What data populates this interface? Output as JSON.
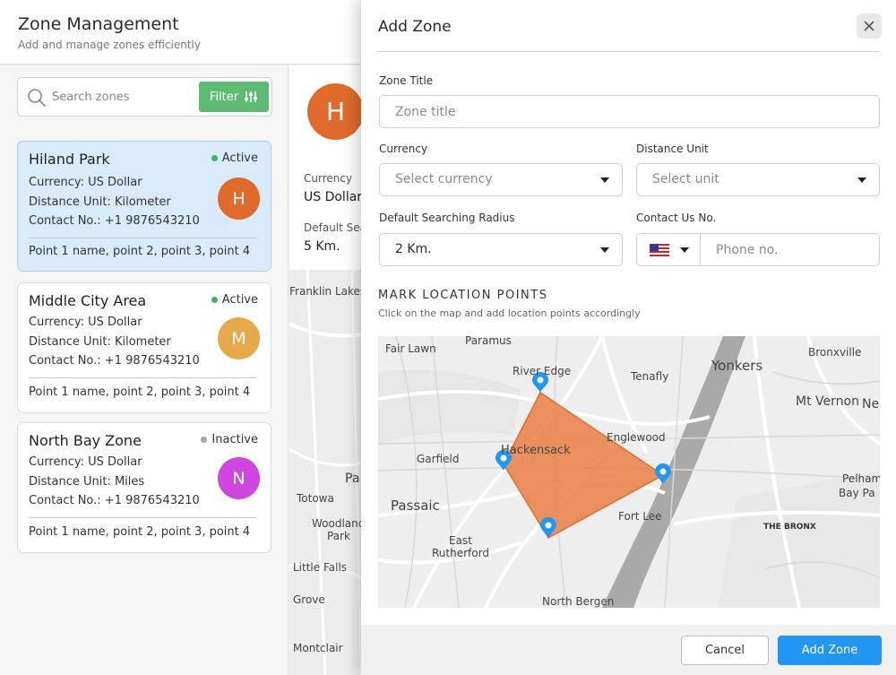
{
  "header": {
    "title": "Zone Management",
    "subtitle": "Add and manage zones efficiently"
  },
  "search": {
    "placeholder": "Search zones",
    "filter_label": "Filter"
  },
  "zones": [
    {
      "name": "Hiland Park",
      "status": "Active",
      "currency": "Currency: US Dollar",
      "distance_unit": "Distance Unit: Kilometer",
      "contact": "Contact No.:  +1 9876543210",
      "initial": "H",
      "points": "Point 1 name, point 2, point 3, point 4"
    },
    {
      "name": "Middle City Area",
      "status": "Active",
      "currency": "Currency: US Dollar",
      "distance_unit": "Distance Unit: Kilometer",
      "contact": "Contact No.:  +1 9876543210",
      "initial": "M",
      "points": "Point 1 name, point 2, point 3, point 4"
    },
    {
      "name": "North Bay Zone",
      "status": "Inactive",
      "currency": "Currency: US Dollar",
      "distance_unit": "Distance Unit: Miles",
      "contact": "Contact No.:  +1 9876543210",
      "initial": "N",
      "points": "Point 1 name, point 2, point 3, point 4"
    }
  ],
  "detail": {
    "initial": "H",
    "currency_label": "Currency",
    "currency_value": "US Dollar",
    "radius_label": "Default Sea",
    "radius_value": "5 Km.",
    "map_labels": [
      "Franklin Lakes",
      "Pa",
      "Totowa",
      "Woodland",
      "Park",
      "Little Falls",
      "Grove",
      "Montclair"
    ]
  },
  "drawer": {
    "title": "Add Zone",
    "zone_title_label": "Zone Title",
    "zone_title_placeholder": "Zone title",
    "currency_label": "Currency",
    "currency_placeholder": "Select currency",
    "distance_unit_label": "Distance Unit",
    "distance_unit_placeholder": "Select unit",
    "radius_label": "Default Searching Radius",
    "radius_value": "2 Km.",
    "contact_label": "Contact Us No.",
    "phone_placeholder": "Phone no.",
    "section_title": "MARK LOCATION POINTS",
    "section_subtitle": "Click on the map and add location points accordingly",
    "cancel_label": "Cancel",
    "submit_label": "Add Zone"
  },
  "map": {
    "labels": {
      "fair_lawn": "Fair Lawn",
      "paramus": "Paramus",
      "river_edge": "River Edge",
      "yonkers": "Yonkers",
      "bronxville": "Bronxville",
      "tenafly": "Tenafly",
      "mt_vernon": "Mt Vernon",
      "ne": "Ne",
      "hackensack": "Hackensack",
      "englewood": "Englewood",
      "garfield": "Garfield",
      "passaic": "Passaic",
      "fort_lee": "Fort Lee",
      "pelham": "Pelham",
      "bay_pa": "Bay Pa",
      "the_bronx": "THE BRONX",
      "east": "East",
      "rutherford": "Rutherford",
      "north_bergen": "North Bergen"
    }
  },
  "colors": {
    "accent_blue": "#2196f3",
    "filter_green": "#5cba72",
    "active_dot": "#3cb55a",
    "inactive_dot": "#a8a8a8",
    "zone_fill": "#e8834a",
    "avatar_h": "#e06a2b",
    "avatar_m": "#e6a94a",
    "avatar_n": "#cf45e0",
    "selected_card": "#d9ebfb"
  }
}
